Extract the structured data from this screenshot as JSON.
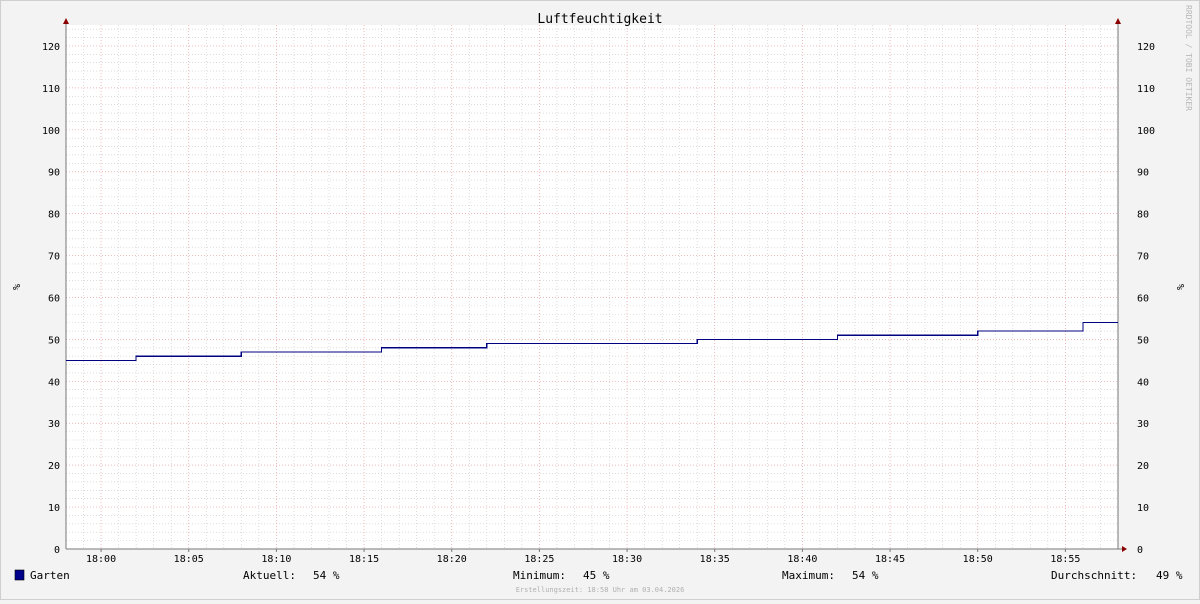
{
  "chart_data": {
    "type": "line",
    "title": "Luftfeuchtigkeit",
    "ylabel_left": "%",
    "ylabel_right": "%",
    "ylim": [
      0,
      125
    ],
    "yticks": [
      0,
      10,
      20,
      30,
      40,
      50,
      60,
      70,
      80,
      90,
      100,
      110,
      120
    ],
    "x_range_min": [
      -2,
      58
    ],
    "xticks": [
      "18:00",
      "18:05",
      "18:10",
      "18:15",
      "18:20",
      "18:25",
      "18:30",
      "18:35",
      "18:40",
      "18:45",
      "18:50",
      "18:55"
    ],
    "grid": true,
    "series": [
      {
        "name": "Garten",
        "color": "#000080",
        "steps": [
          {
            "x": -2,
            "y": 45
          },
          {
            "x": 2,
            "y": 46
          },
          {
            "x": 8,
            "y": 47
          },
          {
            "x": 16,
            "y": 48
          },
          {
            "x": 22,
            "y": 49
          },
          {
            "x": 34,
            "y": 50
          },
          {
            "x": 42,
            "y": 51
          },
          {
            "x": 50,
            "y": 52
          },
          {
            "x": 56,
            "y": 54
          },
          {
            "x": 58,
            "y": 54
          }
        ]
      }
    ],
    "watermark": "RRDTOOL / TOBI OETIKER"
  },
  "legend": {
    "series_name": "Garten",
    "swatch_color": "#00008b",
    "aktuell_label": "Aktuell:",
    "aktuell_value": "54 %",
    "minimum_label": "Minimum:",
    "minimum_value": "45 %",
    "maximum_label": "Maximum:",
    "maximum_value": "54 %",
    "durchschnitt_label": "Durchschnitt:",
    "durchschnitt_value": "49 %"
  },
  "footer": "Erstellungszeit: 18:58 Uhr am 03.04.2026",
  "colors": {
    "background": "#f3f3f3",
    "plot_background": "#ffffff",
    "major_grid": "#e8a0a0",
    "minor_grid": "#c8c8c8",
    "axis": "#777777",
    "arrow": "#8b0000",
    "line": "#000080"
  }
}
